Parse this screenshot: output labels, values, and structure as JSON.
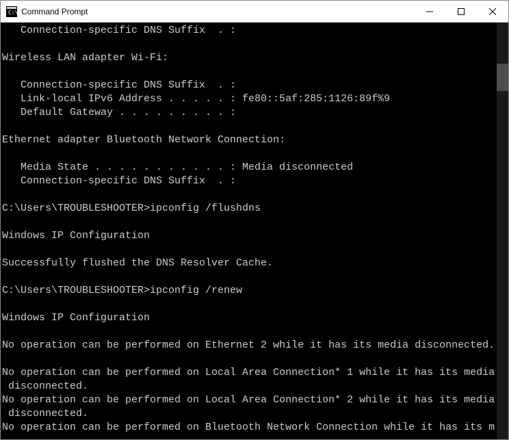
{
  "window": {
    "title": "Command Prompt"
  },
  "terminal": {
    "lines": [
      {
        "text": "Connection-specific DNS Suffix  . :",
        "indent": true
      },
      {
        "blank": true
      },
      {
        "text": "Wireless LAN adapter Wi-Fi:"
      },
      {
        "blank": true
      },
      {
        "text": "Connection-specific DNS Suffix  . :",
        "indent": true
      },
      {
        "text": "Link-local IPv6 Address . . . . . : fe80::5af:285:1126:89f%9",
        "indent": true
      },
      {
        "text": "Default Gateway . . . . . . . . . :",
        "indent": true
      },
      {
        "blank": true
      },
      {
        "text": "Ethernet adapter Bluetooth Network Connection:"
      },
      {
        "blank": true
      },
      {
        "text": "Media State . . . . . . . . . . . : Media disconnected",
        "indent": true
      },
      {
        "text": "Connection-specific DNS Suffix  . :",
        "indent": true
      },
      {
        "blank": true
      },
      {
        "text": "C:\\Users\\TROUBLESHOOTER>ipconfig /flushdns"
      },
      {
        "blank": true
      },
      {
        "text": "Windows IP Configuration"
      },
      {
        "blank": true
      },
      {
        "text": "Successfully flushed the DNS Resolver Cache."
      },
      {
        "blank": true
      },
      {
        "text": "C:\\Users\\TROUBLESHOOTER>ipconfig /renew"
      },
      {
        "blank": true
      },
      {
        "text": "Windows IP Configuration"
      },
      {
        "blank": true
      },
      {
        "text": "No operation can be performed on Ethernet 2 while it has its media disconnected."
      },
      {
        "blank": true
      },
      {
        "text": "No operation can be performed on Local Area Connection* 1 while it has its media"
      },
      {
        "text": "disconnected.",
        "continuation": true
      },
      {
        "text": "No operation can be performed on Local Area Connection* 2 while it has its media"
      },
      {
        "text": "disconnected.",
        "continuation": true
      },
      {
        "text": "No operation can be performed on Bluetooth Network Connection while it has its m"
      }
    ]
  }
}
